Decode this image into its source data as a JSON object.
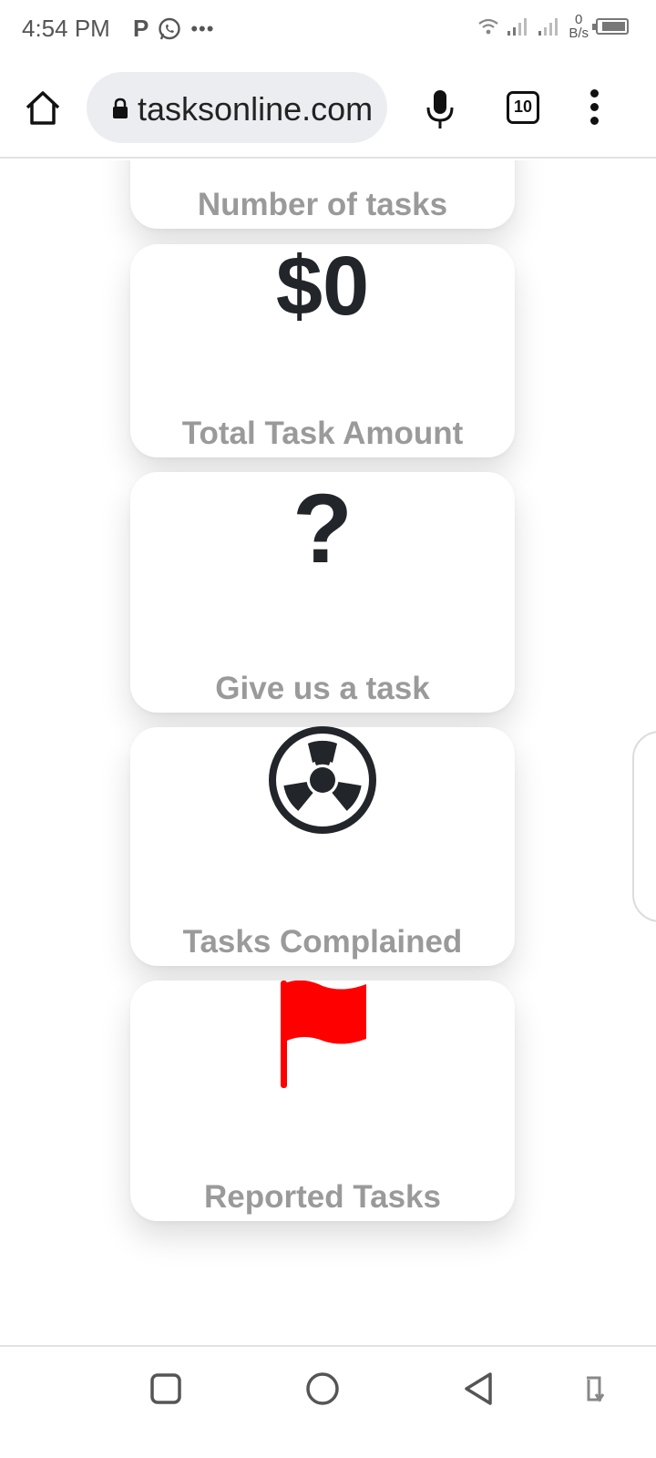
{
  "status_bar": {
    "time": "4:54 PM",
    "left_icons": [
      "parking-icon",
      "whatsapp-icon",
      "more-notifications-icon"
    ],
    "p_label": "P",
    "dots": "•••",
    "net_speed_value": "0",
    "net_speed_unit": "B/s",
    "battery_level": 0.9
  },
  "browser": {
    "url": "tasksonline.com",
    "tab_count": "10"
  },
  "cards": [
    {
      "label": "Number of tasks",
      "figure": ""
    },
    {
      "label": "Total Task Amount",
      "figure": "$0"
    },
    {
      "label": "Give us a task",
      "figure": "?",
      "icon": "question-icon"
    },
    {
      "label": "Tasks Complained",
      "icon": "radiation-icon"
    },
    {
      "label": "Reported Tasks",
      "icon": "flag-icon"
    }
  ],
  "colors": {
    "label_gray": "#9a9a9a",
    "figure_dark": "#22252a",
    "flag_red": "#ff0000"
  },
  "nav_bar": {
    "buttons": [
      "recents-square-icon",
      "home-circle-icon",
      "back-triangle-icon",
      "rotate-icon"
    ]
  }
}
